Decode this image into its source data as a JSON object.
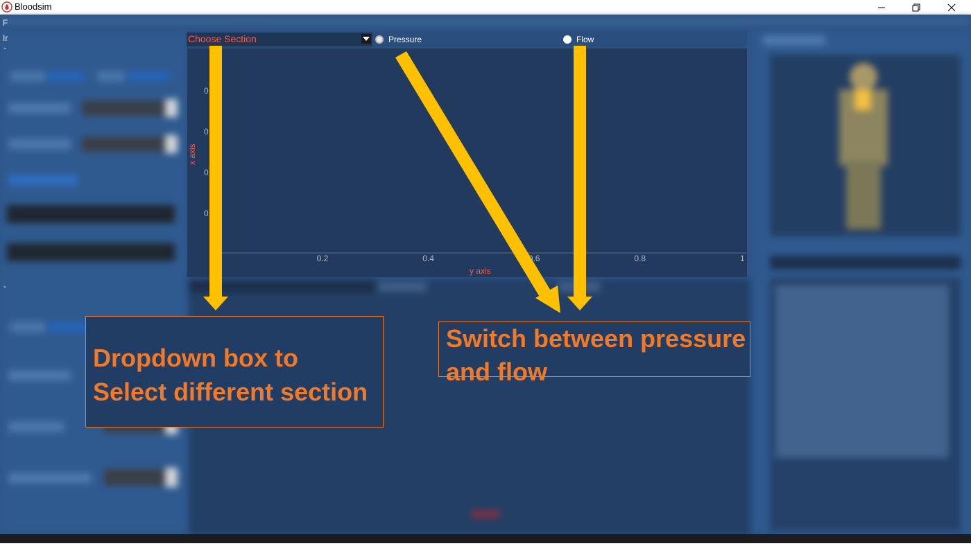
{
  "window": {
    "title": "Bloodsim",
    "controls": [
      "minimize",
      "restore",
      "close"
    ]
  },
  "chart_panel": {
    "dropdown": {
      "value": "Choose Section"
    },
    "radios": [
      {
        "label": "Pressure",
        "selected": false
      },
      {
        "label": "Flow",
        "selected": false
      }
    ]
  },
  "chart_data": {
    "type": "line",
    "xlabel": "y axis",
    "ylabel": "x axis",
    "x_ticks": [
      "0.2",
      "0.4",
      "0.6",
      "0.8",
      "1"
    ],
    "y_ticks": [
      "0",
      "0",
      "0",
      "0"
    ],
    "xlim": [
      0,
      1
    ],
    "series": []
  },
  "annotations": {
    "dropdown_note": {
      "lines": [
        "Dropdown box to",
        "Select different section"
      ]
    },
    "switch_note": {
      "lines": [
        "Switch between pressure",
        "and flow"
      ]
    }
  },
  "colors": {
    "annotation": "#f07a2a",
    "arrow": "#ffc000",
    "axis_label": "#ff5a4a",
    "background": "#2c5282"
  },
  "left_edge_text": [
    "F",
    "Ir",
    "-",
    "-"
  ]
}
